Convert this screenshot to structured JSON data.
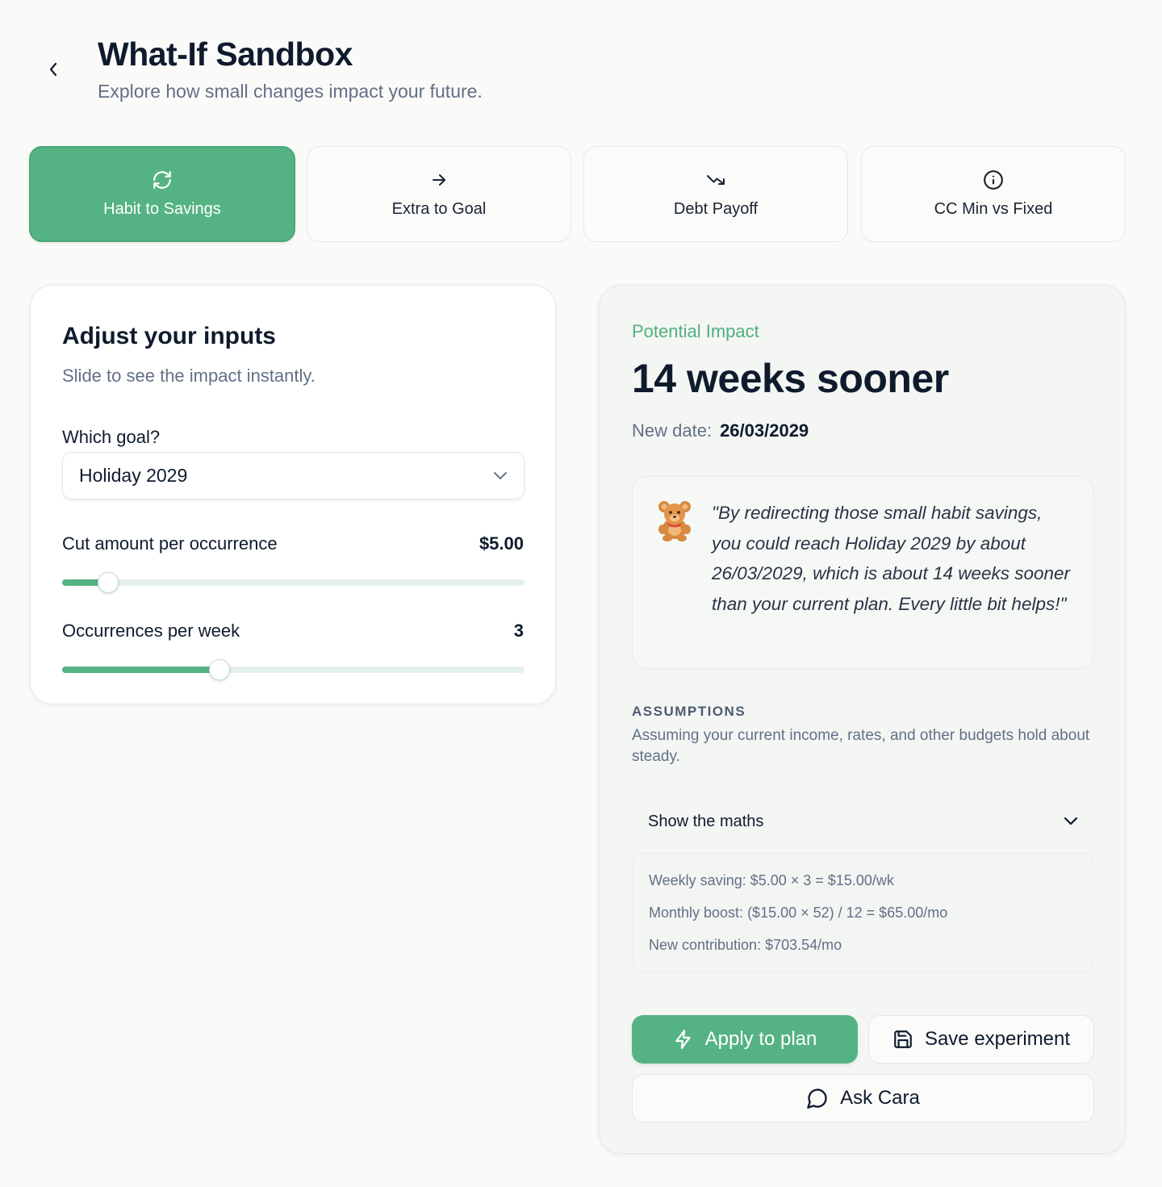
{
  "header": {
    "title": "What-If Sandbox",
    "subtitle": "Explore how small changes impact your future."
  },
  "tabs": [
    {
      "label": "Habit to Savings",
      "icon": "refresh-icon",
      "active": true
    },
    {
      "label": "Extra to Goal",
      "icon": "arrow-right-icon",
      "active": false
    },
    {
      "label": "Debt Payoff",
      "icon": "trending-down-icon",
      "active": false
    },
    {
      "label": "CC Min vs Fixed",
      "icon": "info-icon",
      "active": false
    }
  ],
  "inputs": {
    "title": "Adjust your inputs",
    "subtitle": "Slide to see the impact instantly.",
    "goal_label": "Which goal?",
    "goal_value": "Holiday 2029",
    "cut_label": "Cut amount per occurrence",
    "cut_value": "$5.00",
    "cut_slider_fraction": 0.1,
    "occ_label": "Occurrences per week",
    "occ_value": "3",
    "occ_slider_fraction": 0.34
  },
  "impact": {
    "eyebrow": "Potential Impact",
    "headline": "14 weeks sooner",
    "new_date_label": "New date:",
    "new_date_value": "26/03/2029",
    "quote": "\"By redirecting those small habit savings, you could reach Holiday 2029 by about 26/03/2029, which is about 14 weeks sooner than your current plan. Every little bit helps!\"",
    "assumptions_title": "ASSUMPTIONS",
    "assumptions_text": "Assuming your current income, rates, and other budgets hold about steady.",
    "maths_toggle": "Show the maths",
    "maths": [
      "Weekly saving: $5.00 × 3 = $15.00/wk",
      "Monthly boost: ($15.00 × 52) / 12 = $65.00/mo",
      "New contribution: $703.54/mo"
    ]
  },
  "actions": {
    "apply": "Apply to plan",
    "save": "Save experiment",
    "ask": "Ask Cara"
  },
  "colors": {
    "accent": "#55b383",
    "text": "#0f1b2d",
    "muted": "#627086"
  }
}
